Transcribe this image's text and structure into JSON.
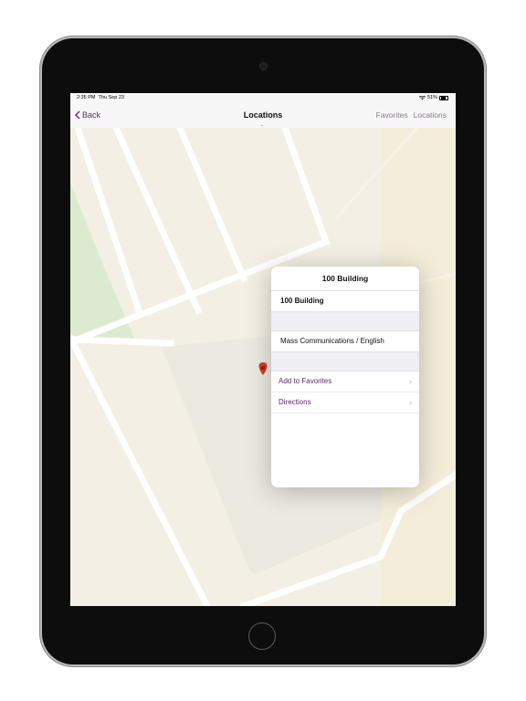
{
  "status_bar": {
    "time": "2:35 PM",
    "date": "Thu Sep 23",
    "battery": "51%"
  },
  "nav": {
    "back_label": "Back",
    "title": "Locations",
    "right_items": [
      "Favorites",
      "Locations"
    ]
  },
  "popover": {
    "title": "100 Building",
    "name": "100 Building",
    "department": "Mass Communications / English",
    "actions": [
      {
        "label": "Add to Favorites",
        "icon": "chevron-right-icon"
      },
      {
        "label": "Directions",
        "icon": "chevron-right-icon"
      }
    ]
  },
  "colors": {
    "accent": "#5b2a62",
    "map_background": "#f3efe4",
    "road": "#ffffff",
    "park": "#dcebd0",
    "pin": "#d93b2b"
  }
}
